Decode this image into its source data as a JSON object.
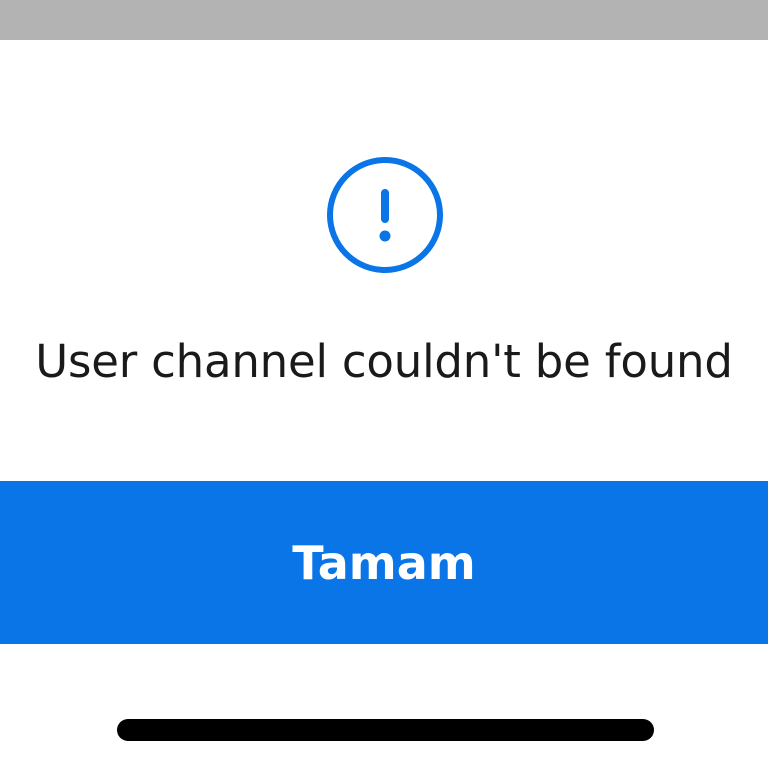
{
  "dialog": {
    "icon": "exclamation-circle-icon",
    "message": "User channel couldn't be found",
    "ok_label": "Tamam"
  },
  "colors": {
    "accent": "#0a75e6",
    "top_bar": "#b3b3b3",
    "text": "#1a1a1a",
    "background": "#ffffff"
  }
}
